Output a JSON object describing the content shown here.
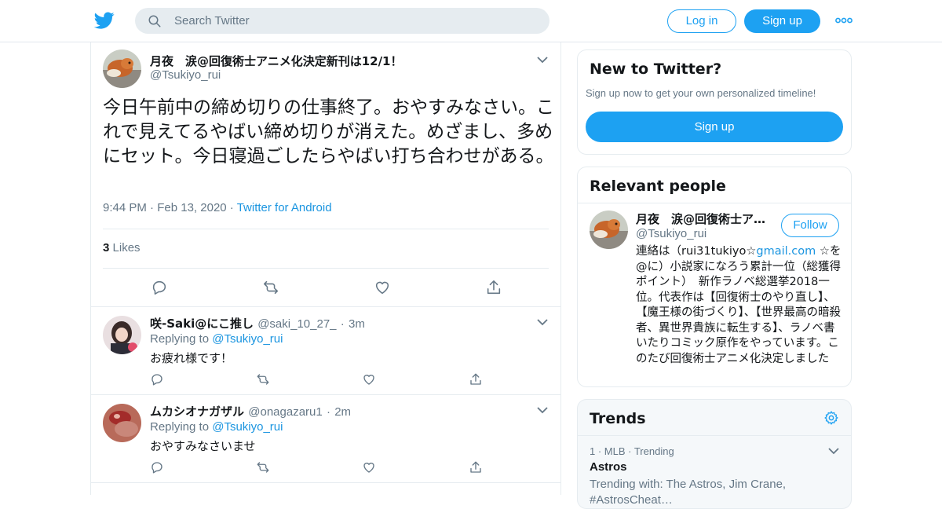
{
  "header": {
    "search_placeholder": "Search Twitter",
    "login_label": "Log in",
    "signup_label": "Sign up",
    "brand_color": "#1da1f2"
  },
  "tweet": {
    "author_name": "月夜　涙@回復術士アニメ化決定新刊は12/1！",
    "author_handle": "@Tsukiyo_rui",
    "text": "今日午前中の締め切りの仕事終了。おやすみなさい。これで見えてるやばい締め切りが消えた。めざまし、多めにセット。今日寝過ごしたらやばい打ち合わせがある。",
    "time": "9:44 PM",
    "date": "Feb 13, 2020",
    "source": "Twitter for Android",
    "likes_count": "3",
    "likes_label": "Likes"
  },
  "replies": [
    {
      "name": "咲-Saki@にこ推し",
      "handle": "@saki_10_27_",
      "time": "3m",
      "replying_prefix": "Replying to",
      "replying_handle": "@Tsukiyo_rui",
      "text": "お疲れ様です！"
    },
    {
      "name": "ムカシオナガザル",
      "handle": "@onagazaru1",
      "time": "2m",
      "replying_prefix": "Replying to",
      "replying_handle": "@Tsukiyo_rui",
      "text": "おやすみなさいませ"
    }
  ],
  "new_to_twitter": {
    "title": "New to Twitter?",
    "subtitle": "Sign up now to get your own personalized timeline!",
    "button": "Sign up"
  },
  "relevant_people": {
    "title": "Relevant people",
    "name": "月夜　涙@回復術士ア…",
    "handle": "@Tsukiyo_rui",
    "follow_label": "Follow",
    "bio_before": "連絡は（rui31tukiyo☆",
    "bio_link": "gmail.com",
    "bio_after": " ☆を@に）小説家になろう累計一位（総獲得ポイント）　新作ラノベ総選挙2018一位。代表作は【回復術士のやり直し】、【魔王様の街づくり】、【世界最高の暗殺者、異世界貴族に転生する】、ラノベ書いたりコミック原作をやっています。このたび回復術士アニメ化決定しました"
  },
  "trends": {
    "title": "Trends",
    "items": [
      {
        "rank": "1",
        "category": "MLB · Trending",
        "name": "Astros",
        "trending_with": "Trending with: The Astros, Jim Crane, #AstrosCheat…"
      }
    ]
  }
}
